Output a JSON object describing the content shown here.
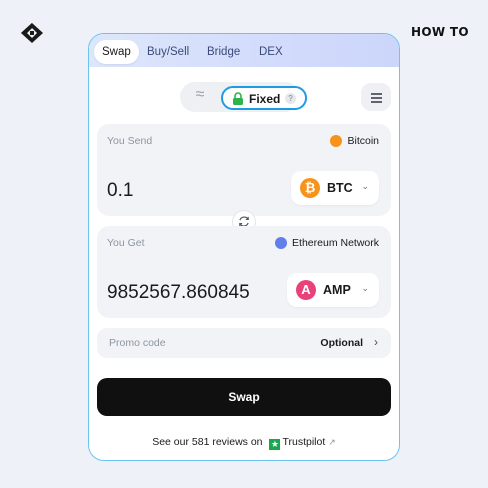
{
  "header": {
    "how_to": "HOW TO"
  },
  "tabs": [
    {
      "label": "Swap"
    },
    {
      "label": "Buy/Sell"
    },
    {
      "label": "Bridge"
    },
    {
      "label": "DEX"
    }
  ],
  "rate_mode": {
    "fixed_label": "Fixed",
    "help": "?"
  },
  "send": {
    "label": "You Send",
    "network": "Bitcoin",
    "amount": "0.1",
    "ticker": "BTC",
    "coin_glyph": "₿"
  },
  "get": {
    "label": "You Get",
    "network": "Ethereum Network",
    "amount": "9852567.860845",
    "ticker": "AMP",
    "coin_glyph": "A"
  },
  "promo": {
    "label": "Promo code",
    "optional": "Optional"
  },
  "swap_button": {
    "label": "Swap"
  },
  "reviews": {
    "text": "See our 581 reviews on",
    "brand": "Trustpilot"
  },
  "colors": {
    "accent": "#1f9be3",
    "btc": "#f7931a",
    "eth": "#627eea",
    "amp": "#e9427a",
    "trustpilot": "#1aa64b"
  }
}
